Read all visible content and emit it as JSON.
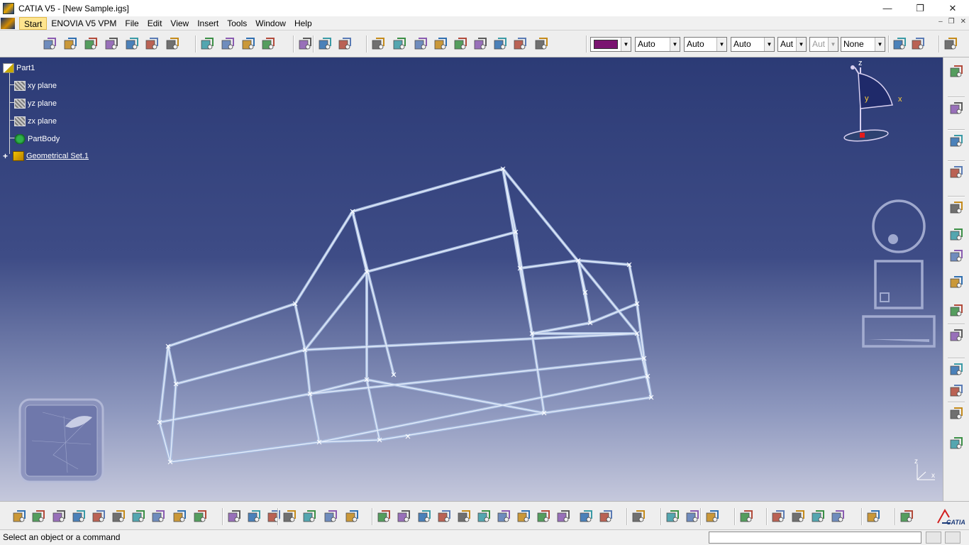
{
  "window": {
    "title": "CATIA V5 - [New Sample.igs]",
    "minimize_glyph": "—",
    "restore_glyph": "❐",
    "close_glyph": "✕"
  },
  "menubar": {
    "items": [
      "Start",
      "ENOVIA V5 VPM",
      "File",
      "Edit",
      "View",
      "Insert",
      "Tools",
      "Window",
      "Help"
    ],
    "doc_min": "–",
    "doc_restore": "❐",
    "doc_close": "✕"
  },
  "properties_toolbar": {
    "color_value": "#7a1470",
    "combo1": "Auto",
    "combo2": "Auto",
    "combo3": "Auto",
    "combo4": "Aut",
    "combo5": "Aut",
    "combo6": "None"
  },
  "spec_tree": {
    "root": "Part1",
    "items": [
      "xy plane",
      "yz plane",
      "zx plane",
      "PartBody",
      "Geometrical Set.1"
    ]
  },
  "compass": {
    "x_label": "x",
    "y_label": "y",
    "z_label": "z"
  },
  "corner_axis": {
    "x_label": "x",
    "z_label": "z"
  },
  "status": {
    "message": "Select an object or a command",
    "command_value": ""
  },
  "icons": {
    "top": [
      "sketch-icon",
      "pad-icon",
      "pocket-icon",
      "hole-icon",
      "rib-icon",
      "shaft-icon",
      "groove-icon",
      "extrude-icon",
      "point-icon",
      "line-icon",
      "plane-icon",
      "measure-icon",
      "sweep-icon",
      "fill-icon",
      "loft-icon",
      "boundary-icon",
      "join-icon",
      "heal-icon",
      "extract-icon",
      "split-icon",
      "trim-icon",
      "paint-icon",
      "catalog-icon"
    ],
    "right": [
      "sketcher-icon",
      "select-icon",
      "annotation-icon",
      "surface-icon",
      "measure-icon",
      "snap-icon",
      "grid-icon",
      "constraint-icon",
      "transform-icon",
      "publish-icon",
      "knowledge-icon",
      "text-icon",
      "flag-icon",
      "cut-icon"
    ],
    "bottom": [
      "new-icon",
      "open-icon",
      "save-icon",
      "print-icon",
      "cut-icon",
      "copy-icon",
      "paste-icon",
      "undo-icon",
      "redo-icon",
      "whats-this-icon",
      "formula-icon",
      "comment-icon",
      "pointer-icon",
      "table-icon",
      "tree-icon",
      "lock-icon",
      "measure-icon",
      "fly-icon",
      "fit-all-icon",
      "pan-icon",
      "rotate-icon",
      "zoom-in-icon",
      "zoom-out-icon",
      "normal-view-icon",
      "multi-view-icon",
      "iso-view-icon",
      "shading-icon",
      "hide-show-icon",
      "swap-icon",
      "render-icon",
      "analysis-icon",
      "apply-material-icon",
      "camera-icon",
      "catia-logo"
    ]
  }
}
